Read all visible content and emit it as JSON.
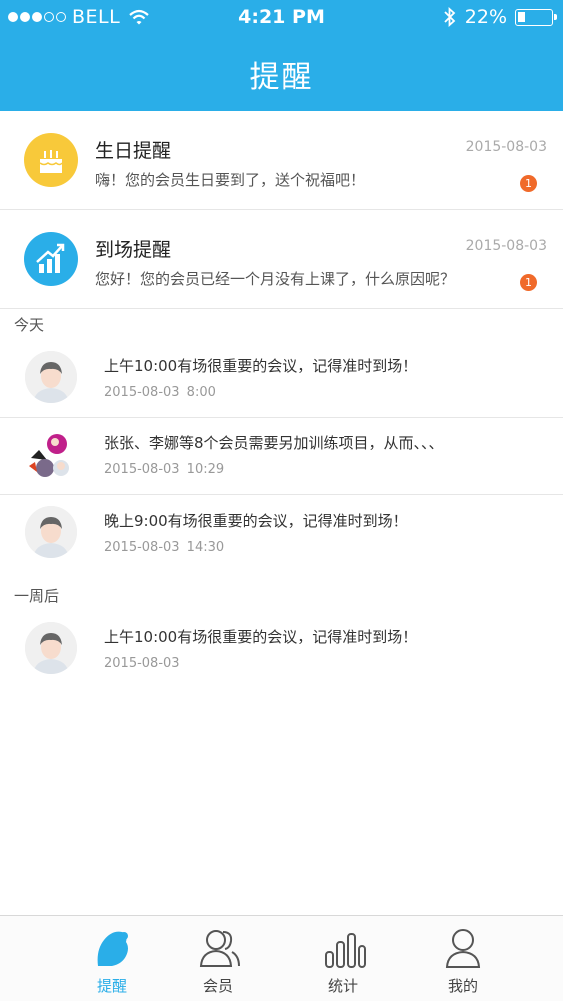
{
  "status_bar": {
    "carrier": "BELL",
    "time": "4:21 PM",
    "battery": "22%",
    "battery_level": 0.22
  },
  "header": {
    "title": "提醒"
  },
  "reminders": [
    {
      "title": "生日提醒",
      "desc": "嗨！您的会员生日要到了，送个祝福吧！",
      "date": "2015-08-03",
      "badge": "1",
      "icon": "birthday-cake-icon",
      "color": "#f8c93a"
    },
    {
      "title": "到场提醒",
      "desc": "您好！您的会员已经一个月没有上课了，什么原因呢？",
      "date": "2015-08-03",
      "badge": "1",
      "icon": "attendance-chart-icon",
      "color": "#2aaee8"
    }
  ],
  "sections": {
    "today": {
      "label": "今天"
    },
    "week": {
      "label": "一周后"
    }
  },
  "notices": [
    {
      "text": "上午10:00有场很重要的会议，记得准时到场！",
      "date": "2015-08-03 8:00"
    },
    {
      "text": "张张、李娜等8个会员需要另加训练项目，从而、、、",
      "date": "2015-08-03 10:29"
    },
    {
      "text": "晚上9:00有场很重要的会议，记得准时到场！",
      "date": "2015-08-03 14:30"
    },
    {
      "text": "上午10:00有场很重要的会议，记得准时到场！",
      "date": "2015-08-03"
    }
  ],
  "tabs": [
    {
      "label": "提醒",
      "icon": "reminder-icon",
      "active": true
    },
    {
      "label": "会员",
      "icon": "members-icon",
      "active": false
    },
    {
      "label": "统计",
      "icon": "statistics-icon",
      "active": false
    },
    {
      "label": "我的",
      "icon": "profile-icon",
      "active": false
    }
  ],
  "colors": {
    "primary": "#2aaee8",
    "badge": "#f06a2a"
  }
}
